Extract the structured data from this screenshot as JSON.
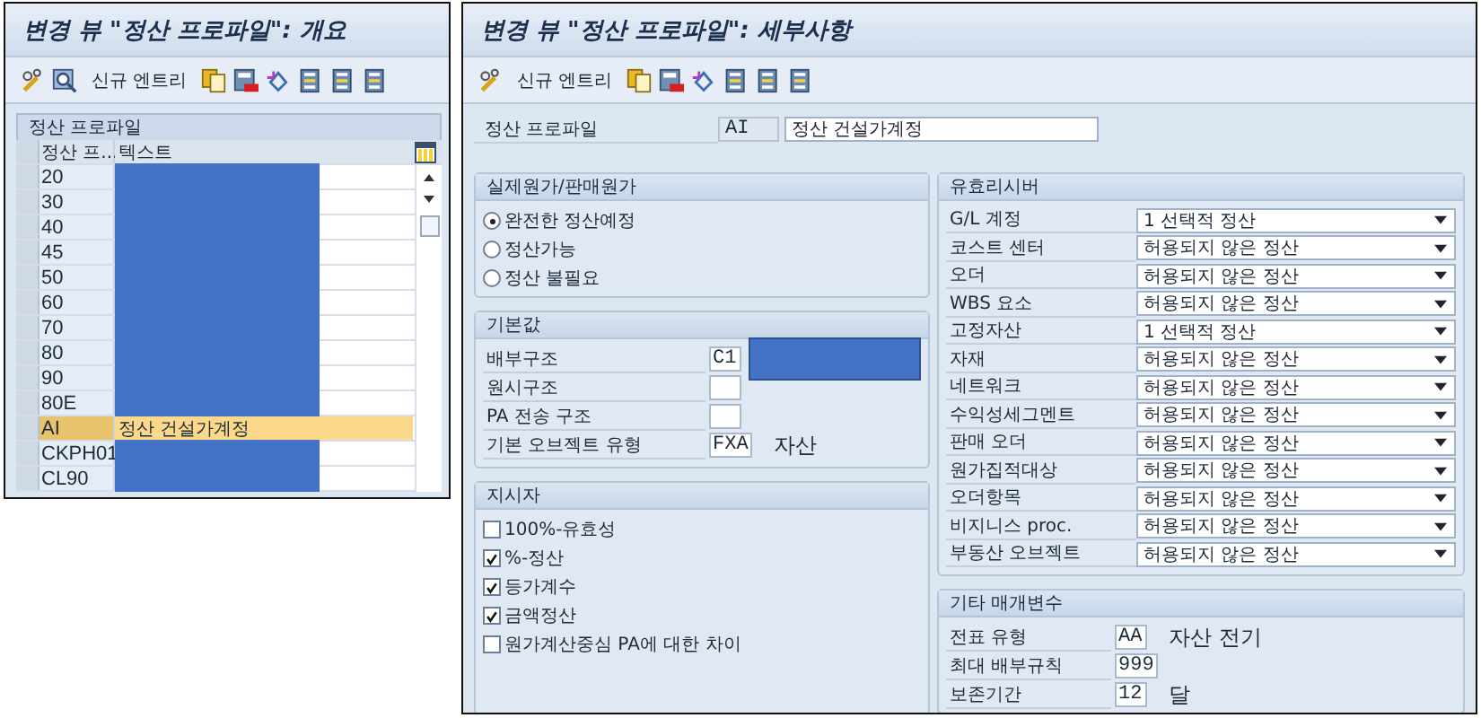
{
  "overview": {
    "title": "변경 뷰 \"정산 프로파일\": 개요",
    "toolbar": [
      {
        "kind": "pencil"
      },
      {
        "kind": "search"
      },
      {
        "kind": "text",
        "label": "신규 엔트리"
      },
      {
        "kind": "copy"
      },
      {
        "kind": "delete"
      },
      {
        "kind": "undo"
      },
      {
        "kind": "page"
      },
      {
        "kind": "page"
      },
      {
        "kind": "page"
      }
    ],
    "section_title": "정산 프로파일",
    "columns": [
      "정산 프...",
      "텍스트"
    ],
    "rows": [
      {
        "code": "20",
        "redacted": true,
        "selected": false
      },
      {
        "code": "30",
        "redacted": true,
        "selected": false
      },
      {
        "code": "40",
        "redacted": true,
        "selected": false
      },
      {
        "code": "45",
        "redacted": true,
        "selected": false
      },
      {
        "code": "50",
        "redacted": true,
        "selected": false
      },
      {
        "code": "60",
        "redacted": true,
        "selected": false
      },
      {
        "code": "70",
        "redacted": true,
        "selected": false
      },
      {
        "code": "80",
        "redacted": true,
        "selected": false
      },
      {
        "code": "90",
        "redacted": true,
        "selected": false
      },
      {
        "code": "80E",
        "redacted": true,
        "selected": false
      },
      {
        "code": "AI",
        "text": "정산 건설가계정",
        "redacted": false,
        "selected": true
      },
      {
        "code": "CKPH01",
        "redacted": true,
        "selected": false
      },
      {
        "code": "CL90",
        "redacted": true,
        "selected": false
      }
    ]
  },
  "detail": {
    "title": "변경 뷰 \"정산 프로파일\": 세부사항",
    "toolbar": [
      {
        "kind": "pencil"
      },
      {
        "kind": "text",
        "label": "신규 엔트리"
      },
      {
        "kind": "copy"
      },
      {
        "kind": "delete"
      },
      {
        "kind": "undo"
      },
      {
        "kind": "page"
      },
      {
        "kind": "page"
      },
      {
        "kind": "page"
      }
    ],
    "profile": {
      "label": "정산 프로파일",
      "code": "AI",
      "text": "정산 건설가계정"
    },
    "actual_costs": {
      "title": "실제원가/판매원가",
      "options": [
        {
          "label": "완전한 정산예정",
          "selected": true
        },
        {
          "label": "정산가능",
          "selected": false
        },
        {
          "label": "정산 불필요",
          "selected": false
        }
      ]
    },
    "defaults": {
      "title": "기본값",
      "fields": [
        {
          "label": "배부구조",
          "value": "C1",
          "redacted": true
        },
        {
          "label": "원시구조",
          "redacted": false
        },
        {
          "label": "PA 전송 구조",
          "redacted": false
        },
        {
          "label": "기본 오브젝트 유형",
          "value": "FXA",
          "note": "자산",
          "redacted": false
        }
      ]
    },
    "indicators": {
      "title": "지시자",
      "items": [
        {
          "label": "100%-유효성",
          "checked": false
        },
        {
          "label": "%-정산",
          "checked": true
        },
        {
          "label": "등가계수",
          "checked": true
        },
        {
          "label": "금액정산",
          "checked": true
        },
        {
          "label": "원가계산중심 PA에 대한 차이",
          "checked": false
        }
      ]
    },
    "receivers": {
      "title": "유효리시버",
      "rows": [
        {
          "label": "G/L 계정",
          "value": "1 선택적 정산"
        },
        {
          "label": "코스트 센터",
          "value": "허용되지 않은 정산"
        },
        {
          "label": "오더",
          "value": "허용되지 않은 정산"
        },
        {
          "label": "WBS 요소",
          "value": "허용되지 않은 정산"
        },
        {
          "label": "고정자산",
          "value": "1 선택적 정산"
        },
        {
          "label": "자재",
          "value": "허용되지 않은 정산"
        },
        {
          "label": "네트워크",
          "value": "허용되지 않은 정산"
        },
        {
          "label": "수익성세그멘트",
          "value": "허용되지 않은 정산"
        },
        {
          "label": "판매 오더",
          "value": "허용되지 않은 정산"
        },
        {
          "label": "원가집적대상",
          "value": "허용되지 않은 정산"
        },
        {
          "label": "오더항목",
          "value": "허용되지 않은 정산"
        },
        {
          "label": "비지니스 proc.",
          "value": "허용되지 않은 정산"
        },
        {
          "label": "부동산 오브젝트",
          "value": "허용되지 않은 정산"
        }
      ]
    },
    "other": {
      "title": "기타 매개변수",
      "fields": [
        {
          "label": "전표 유형",
          "value": "AA",
          "note": "자산 전기"
        },
        {
          "label": "최대 배부규칙",
          "value": "999"
        },
        {
          "label": "보존기간",
          "value": "12",
          "note": "달"
        }
      ]
    }
  }
}
